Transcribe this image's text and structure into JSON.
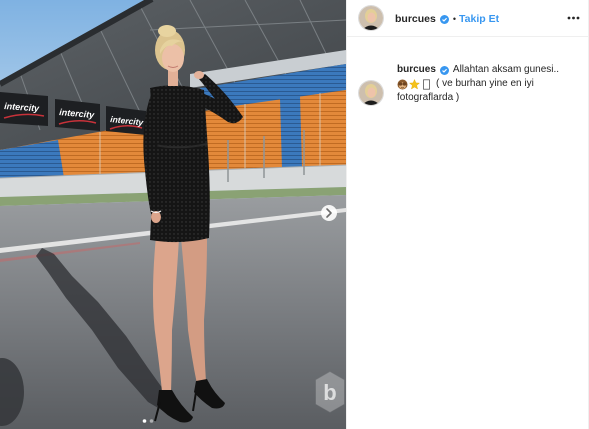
{
  "colors": {
    "accent": "#3897f0",
    "text": "#262626",
    "border": "#efefef"
  },
  "header": {
    "avatar_icon": "profile-avatar-icon",
    "username": "burcues",
    "verified_icon": "verified-badge-icon",
    "separator": "•",
    "follow_label": "Takip Et",
    "menu_icon": "more-options-icon"
  },
  "caption": {
    "avatar_icon": "profile-avatar-icon",
    "username": "burcues",
    "verified_icon": "verified-badge-icon",
    "text_line1": "Allahtan aksam gunesi..",
    "emojis": [
      "see-no-evil-monkey-icon",
      "star-icon",
      "missing-glyph-icon"
    ],
    "text_line2": "( ve burhan yine en iyi",
    "text_line3": "fotograflarda )"
  },
  "photo": {
    "banner_text": "intercity",
    "next_icon": "chevron-right-icon",
    "carousel": {
      "total": 2,
      "active": 1
    },
    "watermark_letter": "b"
  }
}
